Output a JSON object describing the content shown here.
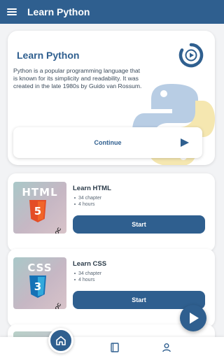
{
  "app": {
    "title": "Learn Python"
  },
  "hero": {
    "title": "Learn Python",
    "description": "Python is a popular programming language that is known for its simplicity and readability. It was created in the late 1980s by Guido van Rossum.",
    "continue_label": "Continue"
  },
  "courses": [
    {
      "title": "Learn HTML",
      "thumb_word": "HTML",
      "shield_number": "5",
      "shield_color": "#e44d26",
      "badge": "EDOC",
      "chapters": "34 chapter",
      "duration": "4 hours",
      "start_label": "Start"
    },
    {
      "title": "Learn CSS",
      "thumb_word": "CSS",
      "shield_number": "3",
      "shield_color": "#1572b6",
      "badge": "EDOC",
      "chapters": "34 chapter",
      "duration": "4 hours",
      "start_label": "Start"
    }
  ],
  "colors": {
    "primary": "#2f5f8f",
    "background": "#f2f3f5"
  },
  "icons": {
    "menu": "menu-icon",
    "logo": "play-logo-icon",
    "home": "home-icon",
    "library": "book-icon",
    "profile": "person-icon",
    "play": "play-icon"
  }
}
